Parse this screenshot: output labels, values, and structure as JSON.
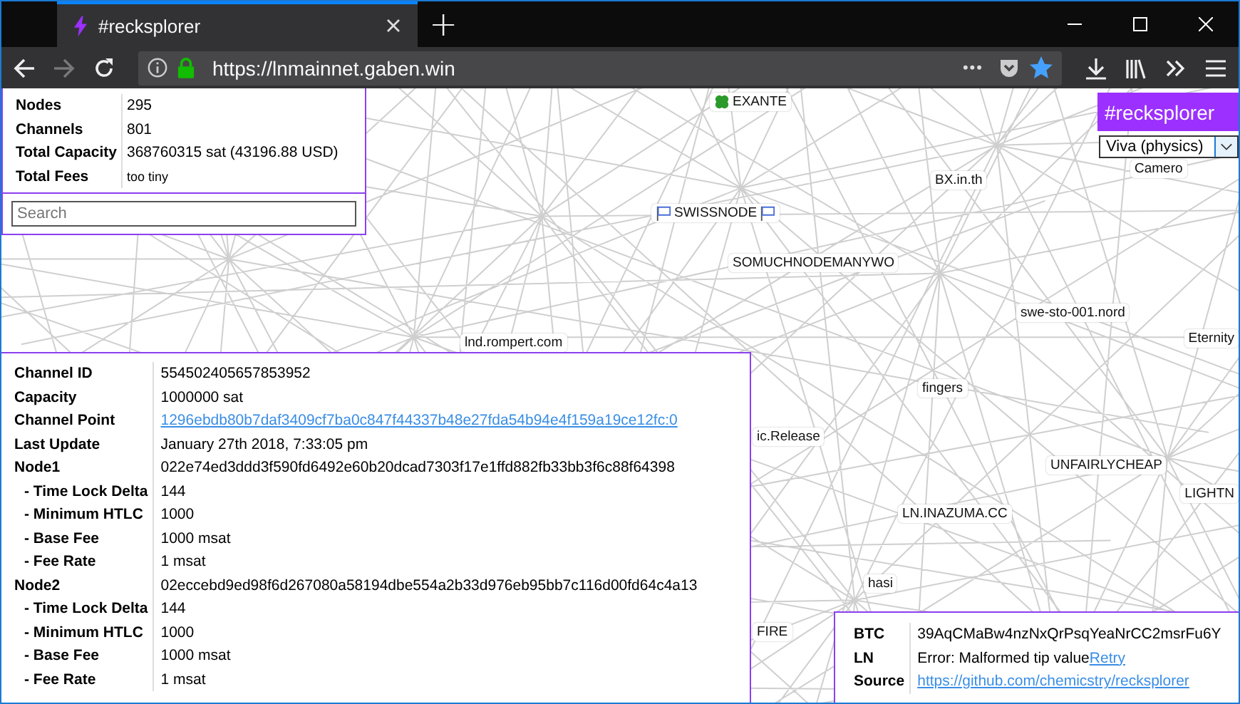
{
  "browser": {
    "tab": {
      "title": "#recksplorer",
      "selected": true
    },
    "new_tab": "+",
    "url": "https://lnmainnet.gaben.win",
    "page_actions": "•••"
  },
  "stats": [
    {
      "label": "Nodes",
      "value": "295"
    },
    {
      "label": "Channels",
      "value": "801"
    },
    {
      "label": "Total Capacity",
      "value": "368760315 sat (43196.88 USD)"
    },
    {
      "label": "Total Fees",
      "value": "too tiny",
      "kind": "small"
    }
  ],
  "search": {
    "placeholder": "Search"
  },
  "brand": "#recksplorer",
  "layout_select": {
    "value": "Viva (physics)"
  },
  "nodes": [
    {
      "label": "EXANTE",
      "kind": "clover"
    },
    {
      "label": "BX.in.th",
      "kind": "plain"
    },
    {
      "label": "SWISSNODE",
      "kind": "flags"
    },
    {
      "label": "SOMUCHNODEMANYWO",
      "kind": "plain"
    },
    {
      "label": "swe-sto-001.nord",
      "kind": "plain"
    },
    {
      "label": "Eternity",
      "kind": "plain"
    },
    {
      "label": "lnd.rompert.com",
      "kind": "plain"
    },
    {
      "label": "fingers",
      "kind": "plain"
    },
    {
      "label": "ic.Release",
      "kind": "plain"
    },
    {
      "label": "UNFAIRLYCHEAP",
      "kind": "plain"
    },
    {
      "label": "LIGHTN",
      "kind": "plain"
    },
    {
      "label": "LN.INAZUMA.CC",
      "kind": "plain"
    },
    {
      "label": "hasi",
      "kind": "plain"
    },
    {
      "label": "FIRE",
      "kind": "plain"
    },
    {
      "label": "Camero",
      "kind": "plain"
    }
  ],
  "channel": [
    {
      "label": "Channel ID",
      "value": "554502405657853952",
      "kind": "text"
    },
    {
      "label": "Capacity",
      "value": "1000000 sat",
      "kind": "text"
    },
    {
      "label": "Channel Point",
      "value": "1296ebdb80b7daf3409cf7ba0c847f44337b48e27fda54b94e4f159a19ce12fc:0",
      "kind": "link"
    },
    {
      "label": "Last Update",
      "value": "January 27th 2018, 7:33:05 pm",
      "kind": "text"
    },
    {
      "label": "Node1",
      "value": "022e74ed3ddd3f590fd6492e60b20dcad7303f17e1ffd882fb33bb3f6c88f64398",
      "kind": "text"
    },
    {
      "label": "- Time Lock Delta",
      "value": "144",
      "kind": "sub"
    },
    {
      "label": "- Minimum HTLC",
      "value": "1000",
      "kind": "sub"
    },
    {
      "label": "- Base Fee",
      "value": "1000 msat",
      "kind": "sub"
    },
    {
      "label": "- Fee Rate",
      "value": "1 msat",
      "kind": "sub"
    },
    {
      "label": "Node2",
      "value": "02eccebd9ed98f6d267080a58194dbe554a2b33d976eb95bb7c116d00fd64c4a13",
      "kind": "text"
    },
    {
      "label": "- Time Lock Delta",
      "value": "144",
      "kind": "sub"
    },
    {
      "label": "- Minimum HTLC",
      "value": "1000",
      "kind": "sub"
    },
    {
      "label": "- Base Fee",
      "value": "1000 msat",
      "kind": "sub"
    },
    {
      "label": "- Fee Rate",
      "value": "1 msat",
      "kind": "sub"
    }
  ],
  "tips": [
    {
      "label": "BTC",
      "value": "39AqCMaBw4nzNxQrPsqYeaNrCC2msrFu6Y",
      "kind": "text"
    },
    {
      "label": "LN",
      "value": "Error: Malformed tip value",
      "link": "Retry",
      "kind": "error"
    },
    {
      "label": "Source",
      "value": "https://github.com/chemicstry/recksplorer",
      "kind": "link"
    }
  ]
}
